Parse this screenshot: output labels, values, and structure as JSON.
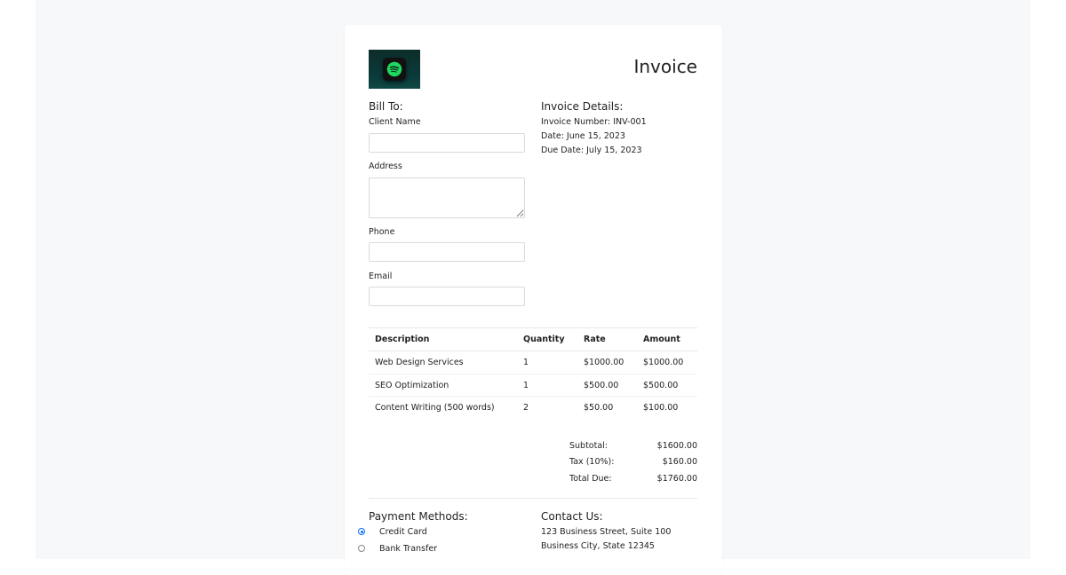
{
  "invoice_title": "Invoice",
  "bill_to": {
    "heading": "Bill To:",
    "client_name_label": "Client Name",
    "address_label": "Address",
    "phone_label": "Phone",
    "email_label": "Email"
  },
  "details": {
    "heading": "Invoice Details:",
    "number": "Invoice Number: INV-001",
    "date": "Date: June 15, 2023",
    "due_date": "Due Date: July 15, 2023"
  },
  "table": {
    "headers": [
      "Description",
      "Quantity",
      "Rate",
      "Amount"
    ],
    "rows": [
      [
        "Web Design Services",
        "1",
        "$1000.00",
        "$1000.00"
      ],
      [
        "SEO Optimization",
        "1",
        "$500.00",
        "$500.00"
      ],
      [
        "Content Writing (500 words)",
        "2",
        "$50.00",
        "$100.00"
      ]
    ]
  },
  "totals": {
    "subtotal_label": "Subtotal:",
    "subtotal_value": "$1600.00",
    "tax_label": "Tax (10%):",
    "tax_value": "$160.00",
    "total_label": "Total Due:",
    "total_value": "$1760.00"
  },
  "payment": {
    "heading": "Payment Methods:",
    "options": [
      "Credit Card",
      "Bank Transfer"
    ],
    "selected": "Credit Card"
  },
  "contact": {
    "heading": "Contact Us:",
    "address_line1": "123 Business Street, Suite 100",
    "address_line2": "Business City, State 12345"
  },
  "colors": {
    "page_bg": "#f7f8fa",
    "card_bg": "#ffffff",
    "logo_green": "#1ed760",
    "radio_accent": "#0d6efd"
  },
  "icons": {
    "logo": "spotify-logo-icon"
  }
}
